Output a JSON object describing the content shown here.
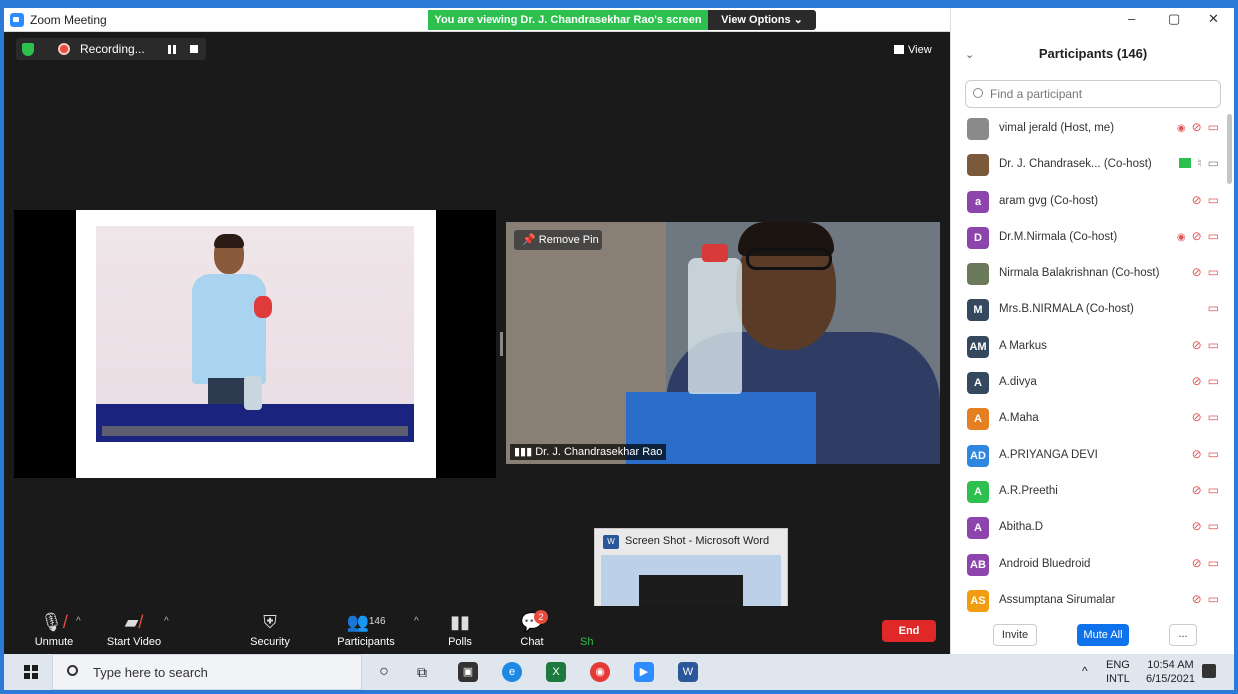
{
  "window": {
    "title": "Zoom Meeting",
    "viewing_banner": "You are viewing Dr. J. Chandrasekhar Rao's screen",
    "view_options": "View Options ⌄",
    "controls": [
      "–",
      "▢",
      "✕"
    ]
  },
  "meeting": {
    "recording_label": "Recording...",
    "view_label": "View",
    "remove_pin": "Remove Pin",
    "camera_name": "Dr. J. Chandrasekhar Rao",
    "thumbnail_title": "Screen Shot - Microsoft Word"
  },
  "toolbar": {
    "unmute": "Unmute",
    "start_video": "Start Video",
    "security": "Security",
    "participants": "Participants",
    "participants_count": "146",
    "polls": "Polls",
    "chat": "Chat",
    "chat_badge": "2",
    "share_partial": "Sh",
    "end": "End"
  },
  "panel": {
    "title": "Participants (146)",
    "search_placeholder": "Find a participant",
    "participants": [
      {
        "name": "vimal jerald (Host, me)",
        "initials": "",
        "color": "#8a8a8a",
        "icons": "rec,mic-off,cam-off"
      },
      {
        "name": "Dr. J. Chandrasek... (Co-host)",
        "initials": "",
        "color": "#7a5a3a",
        "icons": "share,mic-on,cam-on"
      },
      {
        "name": "aram gvg (Co-host)",
        "initials": "a",
        "color": "#8e44ad",
        "icons": "mic-off,cam-off"
      },
      {
        "name": "Dr.M.Nirmala (Co-host)",
        "initials": "D",
        "color": "#8e44ad",
        "icons": "rec,mic-off,cam-off"
      },
      {
        "name": "Nirmala Balakrishnan (Co-host)",
        "initials": "",
        "color": "#6a7a5a",
        "icons": "mic-off,cam-off"
      },
      {
        "name": "Mrs.B.NIRMALA (Co-host)",
        "initials": "M",
        "color": "#34495e",
        "icons": "cam-off"
      },
      {
        "name": "A Markus",
        "initials": "AM",
        "color": "#34495e",
        "icons": "mic-off,cam-off"
      },
      {
        "name": "A.divya",
        "initials": "A",
        "color": "#34495e",
        "icons": "mic-off,cam-off"
      },
      {
        "name": "A.Maha",
        "initials": "A",
        "color": "#e67e22",
        "icons": "mic-off,cam-off"
      },
      {
        "name": "A.PRIYANGA DEVI",
        "initials": "AD",
        "color": "#2e86de",
        "icons": "mic-off,cam-off"
      },
      {
        "name": "A.R.Preethi",
        "initials": "A",
        "color": "#2dc04e",
        "icons": "mic-off,cam-off"
      },
      {
        "name": "Abitha.D",
        "initials": "A",
        "color": "#8e44ad",
        "icons": "mic-off,cam-off"
      },
      {
        "name": "Android Bluedroid",
        "initials": "AB",
        "color": "#8e44ad",
        "icons": "mic-off,cam-off"
      },
      {
        "name": "Assumptana Sirumalar",
        "initials": "AS",
        "color": "#f39c12",
        "icons": "mic-off,cam-off"
      }
    ],
    "invite": "Invite",
    "mute_all": "Mute All",
    "more": "..."
  },
  "taskbar": {
    "search_text": "Type here to search",
    "lang_top": "ENG",
    "lang_bottom": "INTL",
    "time": "10:54 AM",
    "date": "6/15/2021"
  }
}
